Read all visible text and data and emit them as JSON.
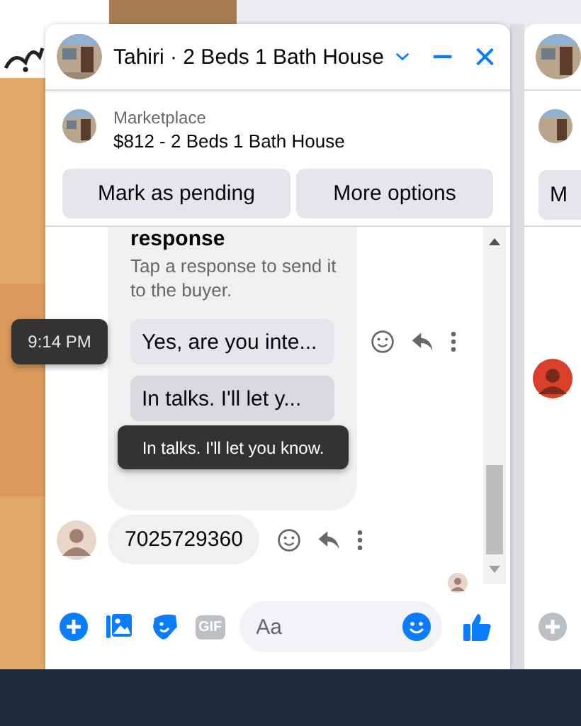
{
  "chat": {
    "title": "Tahiri · 2 Beds 1 Bath House",
    "listing": {
      "source": "Marketplace",
      "title": "$812 - 2 Beds 1 Bath House"
    },
    "actions": [
      {
        "label": "Mark as pending"
      },
      {
        "label": "More options"
      }
    ],
    "quick_replies": {
      "heading": "response",
      "hint": "Tap a response to send it to the buyer.",
      "options": [
        {
          "label": "Yes, are you inte...",
          "hovered": false
        },
        {
          "label": "In talks. I'll let y...",
          "hovered": true
        }
      ]
    },
    "option_tooltip": "In talks. I'll let you know.",
    "time_tooltip": "9:14 PM",
    "messages": [
      {
        "text": "7025729360"
      }
    ],
    "composer": {
      "placeholder": "Aa",
      "gif_label": "GIF"
    }
  },
  "second_window": {
    "button_label": "M"
  }
}
